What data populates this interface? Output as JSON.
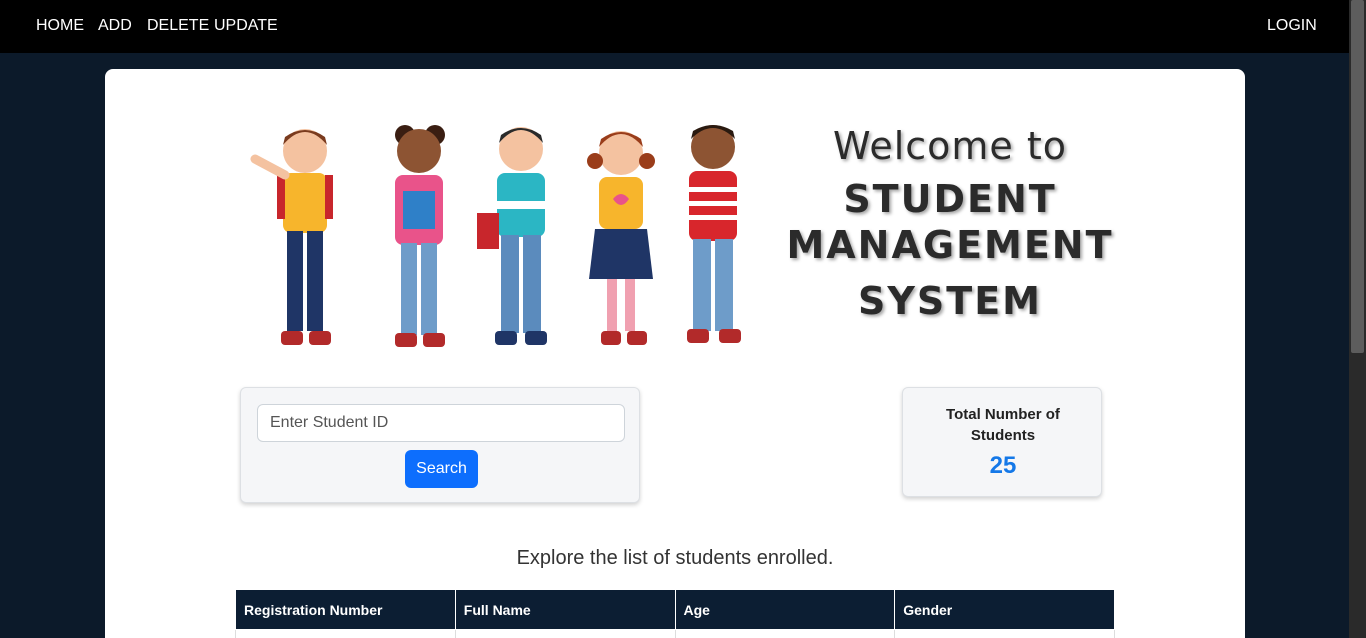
{
  "nav": {
    "home": "HOME",
    "add": "ADD",
    "delete": "DELETE",
    "update": "UPDATE",
    "login": "LOGIN"
  },
  "hero": {
    "welcome": "Welcome to",
    "title_line1": "STUDENT",
    "title_line2": "MANAGEMENT",
    "title_line3": "SYSTEM"
  },
  "search": {
    "placeholder": "Enter Student ID",
    "button_label": "Search"
  },
  "stats": {
    "label": "Total Number of Students",
    "value": "25"
  },
  "explore_text": "Explore the list of students enrolled.",
  "table": {
    "headers": [
      "Registration Number",
      "Full Name",
      "Age",
      "Gender"
    ]
  },
  "colors": {
    "accent": "#0d6efd",
    "page_bg": "#0c1a2a",
    "table_header": "#0c1e33",
    "count": "#1478e8"
  }
}
